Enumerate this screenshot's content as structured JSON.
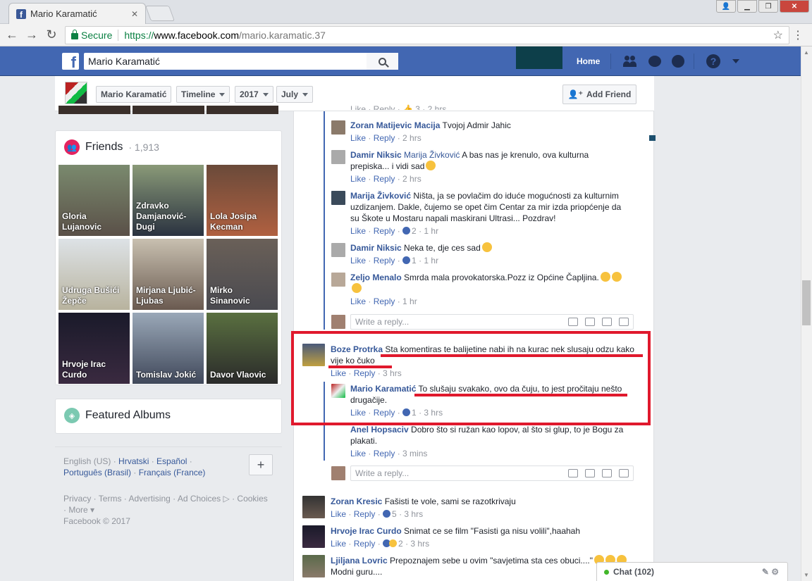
{
  "browser": {
    "tab_title": "Mario Karamatić",
    "url_secure": "Secure",
    "url_proto": "https://",
    "url_host": "www.facebook.com",
    "url_path": "/mario.karamatic.37"
  },
  "fbbar": {
    "search_value": "Mario Karamatić",
    "home": "Home"
  },
  "timeline": {
    "name": "Mario Karamatić",
    "timeline": "Timeline",
    "year": "2017",
    "month": "July",
    "add_friend": "Add Friend"
  },
  "friends": {
    "title": "Friends",
    "count": "· 1,913",
    "items": [
      {
        "name": "Gloria Lujanovic"
      },
      {
        "name": "Zdravko Damjanović-Dugi"
      },
      {
        "name": "Lola Josipa Kecman"
      },
      {
        "name": "Udruga Bušići Žepče"
      },
      {
        "name": "Mirjana Ljubić-Ljubas"
      },
      {
        "name": "Mirko Sinanovic"
      },
      {
        "name": "Hrvoje Irac Curdo"
      },
      {
        "name": "Tomislav Jokić"
      },
      {
        "name": "Davor Vlaovic"
      }
    ]
  },
  "featured": {
    "title": "Featured Albums"
  },
  "languages": {
    "l1": "English (US)",
    "l2": "Hrvatski",
    "l3": "Español",
    "l4": "Português (Brasil)",
    "l5": "Français (France)"
  },
  "footer": {
    "line1": "Privacy · Terms · Advertising · Ad Choices ▷ · Cookies",
    "line2": "· More ▾",
    "line3": "Facebook © 2017"
  },
  "comments": {
    "c0_meta": "Like · Reply · 👍 3 · 2 hrs",
    "c1_name": "Zoran Matijevic Macija",
    "c1_text": "Tvojoj Admir Jahic",
    "c1_time": "2 hrs",
    "c2_name": "Damir Niksic",
    "c2_tag": "Marija Živković",
    "c2_text": "A bas nas je krenulo, ova kulturna prepiska... i vidi sad",
    "c2_time": "2 hrs",
    "c3_name": "Marija Živković",
    "c3_text": "Ništa, ja se povlačim do iduće mogućnosti za kulturnim uzdizanjem. Dakle, čujemo se opet čim Centar za mir izda priopćenje da su Škote u Mostaru napali maskirani Ultrasi... Pozdrav!",
    "c3_likes": "2",
    "c3_time": "1 hr",
    "c4_name": "Damir Niksic",
    "c4_text": "Neka te, dje ces sad",
    "c4_likes": "1",
    "c4_time": "1 hr",
    "c5_name": "Zeljo Menalo",
    "c5_text": "Smrda mala provokatorska.Pozz iz Općine Čapljina.",
    "c5_time": "1 hr",
    "reply_placeholder": "Write a reply...",
    "c6_name": "Boze Protrka",
    "c6_text": "Sta komentiras te balijetine nabi ih na kurac nek slusaju odzu kako vije ko čuko",
    "c6_time": "3 hrs",
    "c7_name": "Mario Karamatić",
    "c7_text": "To slušaju svakako, ovo da čuju, to jest pročitaju nešto drugačije.",
    "c7_likes": "1",
    "c7_time": "3 hrs",
    "c8_name": "Anel Hopsaciv",
    "c8_text": "Dobro što si ružan kao lopov, al što si glup, to je Bogu za plakati.",
    "c8_time": "3 mins",
    "c9_name": "Zoran Kresic",
    "c9_text": "Fašisti te vole, sami se razotkrivaju",
    "c9_likes": "5",
    "c9_time": "3 hrs",
    "c10_name": "Hrvoje Irac Curdo",
    "c10_text": "Snimat ce se film \"Fasisti ga nisu volili\",haahah",
    "c10_likes": "2",
    "c10_time": "3 hrs",
    "c11_name": "Ljiljana Lovric",
    "c11_text": "Prepoznajem sebe u ovim \"savjetima sta ces obuci....\"",
    "c11_text2": "Modni guru....",
    "like": "Like",
    "reply": "Reply"
  },
  "chat": {
    "label": "Chat (102)"
  }
}
